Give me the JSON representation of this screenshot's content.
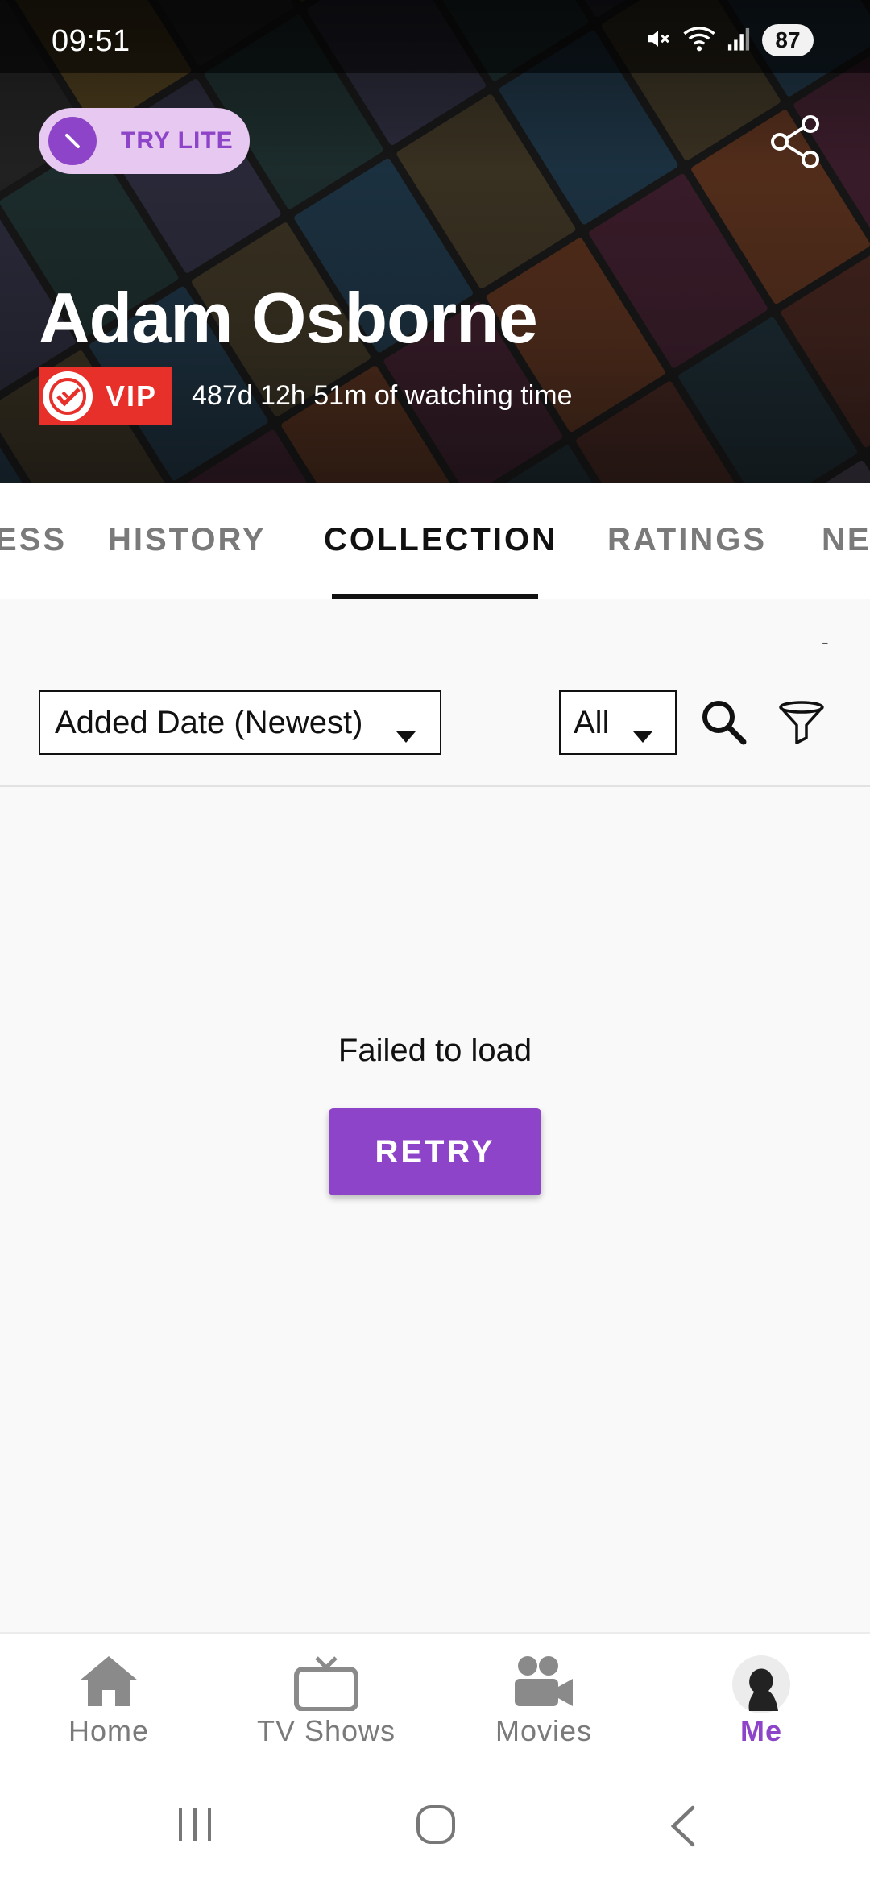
{
  "status_bar": {
    "time": "09:51",
    "battery": "87"
  },
  "header": {
    "try_lite_label": "TRY LITE",
    "user_name": "Adam Osborne",
    "vip_label": "VIP",
    "watching_time": "487d 12h 51m of watching time"
  },
  "tabs": [
    {
      "label": "ESS"
    },
    {
      "label": "HISTORY"
    },
    {
      "label": "COLLECTION"
    },
    {
      "label": "RATINGS"
    },
    {
      "label": "NE"
    }
  ],
  "active_tab": "COLLECTION",
  "filters": {
    "dash": "-",
    "sort_value": "Added Date (Newest)",
    "type_value": "All"
  },
  "content": {
    "message": "Failed to load",
    "retry_label": "RETRY"
  },
  "bottom_nav": [
    {
      "label": "Home",
      "icon": "home-icon"
    },
    {
      "label": "TV Shows",
      "icon": "tv-icon"
    },
    {
      "label": "Movies",
      "icon": "movie-camera-icon"
    },
    {
      "label": "Me",
      "icon": "avatar-icon"
    }
  ],
  "colors": {
    "accent": "#8e44c8",
    "accent_light": "#e6c8f0",
    "vip_red": "#e8302b"
  }
}
